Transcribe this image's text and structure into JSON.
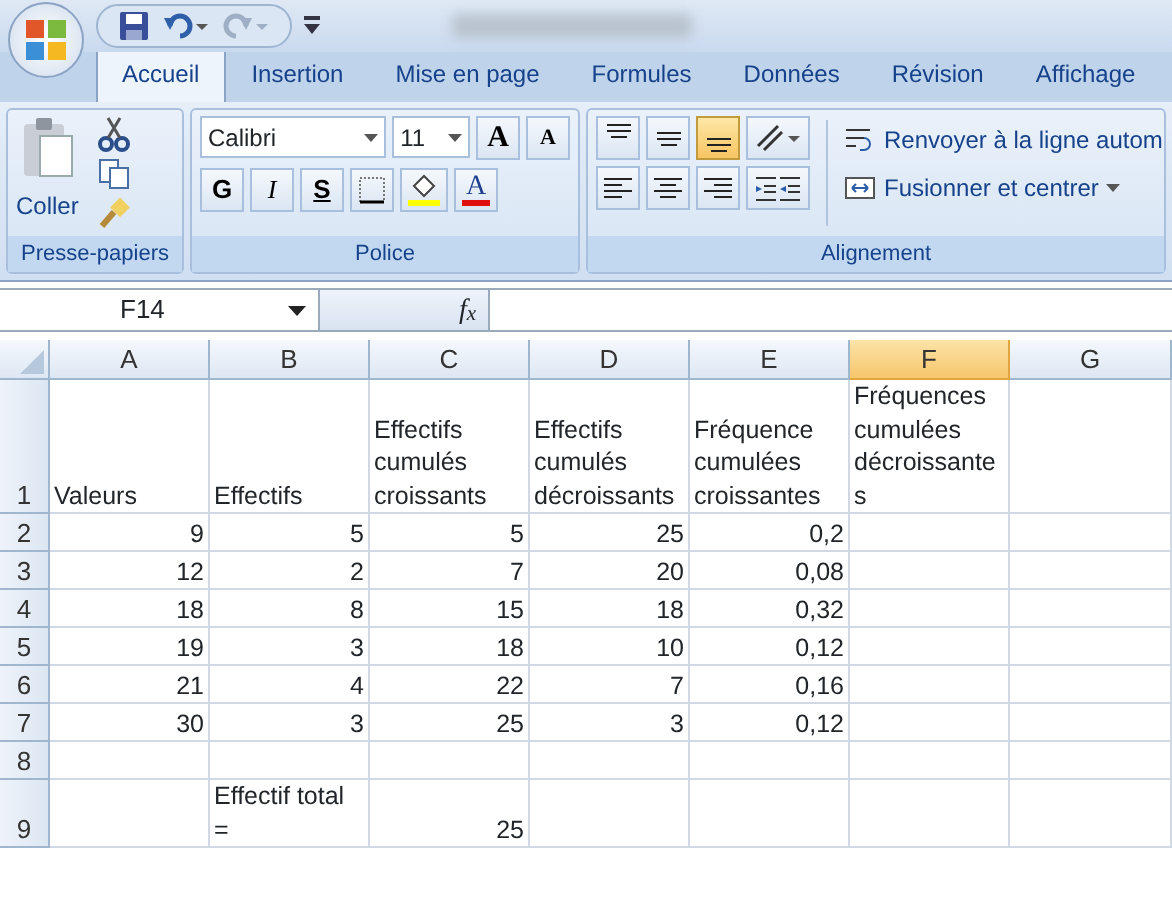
{
  "tabs": [
    {
      "label": "Accueil",
      "selected": true
    },
    {
      "label": "Insertion",
      "selected": false
    },
    {
      "label": "Mise en page",
      "selected": false
    },
    {
      "label": "Formules",
      "selected": false
    },
    {
      "label": "Données",
      "selected": false
    },
    {
      "label": "Révision",
      "selected": false
    },
    {
      "label": "Affichage",
      "selected": false
    }
  ],
  "ribbon": {
    "clipboard": {
      "paste_label": "Coller",
      "group_label": "Presse-papiers"
    },
    "font": {
      "font_name": "Calibri",
      "font_size": "11",
      "grow_label": "A",
      "shrink_label": "A",
      "style_buttons": [
        {
          "label": "G",
          "kind": "bold"
        },
        {
          "label": "I",
          "kind": "italic"
        },
        {
          "label": "S",
          "kind": "underline"
        }
      ],
      "font_color_label": "A",
      "group_label": "Police"
    },
    "alignment": {
      "vertical_buttons": [
        {
          "kind": "top",
          "selected": false
        },
        {
          "kind": "middle",
          "selected": false
        },
        {
          "kind": "bottom",
          "selected": true
        }
      ],
      "horizontal_buttons": [
        {
          "kind": "left",
          "selected": false
        },
        {
          "kind": "center",
          "selected": false
        },
        {
          "kind": "right",
          "selected": false
        }
      ],
      "wrap_label": "Renvoyer à la ligne autom",
      "merge_label": "Fusionner et centrer",
      "group_label": "Alignement"
    }
  },
  "formula_bar": {
    "name_box": "F14",
    "function_label": "f$_{x}$"
  },
  "columns": [
    {
      "label": "A",
      "selected": false
    },
    {
      "label": "B",
      "selected": false
    },
    {
      "label": "C",
      "selected": false
    },
    {
      "label": "D",
      "selected": false
    },
    {
      "label": "E",
      "selected": false
    },
    {
      "label": "F",
      "selected": true
    },
    {
      "label": "G",
      "selected": false
    }
  ],
  "rows": [
    {
      "number": "1",
      "cells": {
        "A": {
          "text": "Valeurs",
          "kind": "text"
        },
        "B": {
          "text": "Effectifs",
          "kind": "text"
        },
        "C": {
          "text": "Effectifs cumulés croissants",
          "kind": "text"
        },
        "D": {
          "text": "Effectifs cumulés décroissants",
          "kind": "text"
        },
        "E": {
          "text": "Fréquence cumulées croissantes",
          "kind": "text"
        },
        "F": {
          "text": "Fréquences cumulées décroissantes",
          "kind": "text"
        }
      }
    },
    {
      "number": "2",
      "cells": {
        "A": {
          "text": "9",
          "kind": "number"
        },
        "B": {
          "text": "5",
          "kind": "number"
        },
        "C": {
          "text": "5",
          "kind": "number"
        },
        "D": {
          "text": "25",
          "kind": "number"
        },
        "E": {
          "text": "0,2",
          "kind": "number"
        }
      }
    },
    {
      "number": "3",
      "cells": {
        "A": {
          "text": "12",
          "kind": "number"
        },
        "B": {
          "text": "2",
          "kind": "number"
        },
        "C": {
          "text": "7",
          "kind": "number"
        },
        "D": {
          "text": "20",
          "kind": "number"
        },
        "E": {
          "text": "0,08",
          "kind": "number"
        }
      }
    },
    {
      "number": "4",
      "cells": {
        "A": {
          "text": "18",
          "kind": "number"
        },
        "B": {
          "text": "8",
          "kind": "number"
        },
        "C": {
          "text": "15",
          "kind": "number"
        },
        "D": {
          "text": "18",
          "kind": "number"
        },
        "E": {
          "text": "0,32",
          "kind": "number"
        }
      }
    },
    {
      "number": "5",
      "cells": {
        "A": {
          "text": "19",
          "kind": "number"
        },
        "B": {
          "text": "3",
          "kind": "number"
        },
        "C": {
          "text": "18",
          "kind": "number"
        },
        "D": {
          "text": "10",
          "kind": "number"
        },
        "E": {
          "text": "0,12",
          "kind": "number"
        }
      }
    },
    {
      "number": "6",
      "cells": {
        "A": {
          "text": "21",
          "kind": "number"
        },
        "B": {
          "text": "4",
          "kind": "number"
        },
        "C": {
          "text": "22",
          "kind": "number"
        },
        "D": {
          "text": "7",
          "kind": "number"
        },
        "E": {
          "text": "0,16",
          "kind": "number"
        }
      }
    },
    {
      "number": "7",
      "cells": {
        "A": {
          "text": "30",
          "kind": "number"
        },
        "B": {
          "text": "3",
          "kind": "number"
        },
        "C": {
          "text": "25",
          "kind": "number"
        },
        "D": {
          "text": "3",
          "kind": "number"
        },
        "E": {
          "text": "0,12",
          "kind": "number"
        }
      }
    },
    {
      "number": "8"
    },
    {
      "number": "9",
      "cells": {
        "B": {
          "text": "Effectif total =",
          "kind": "text"
        },
        "C": {
          "text": "25",
          "kind": "number"
        }
      }
    }
  ]
}
